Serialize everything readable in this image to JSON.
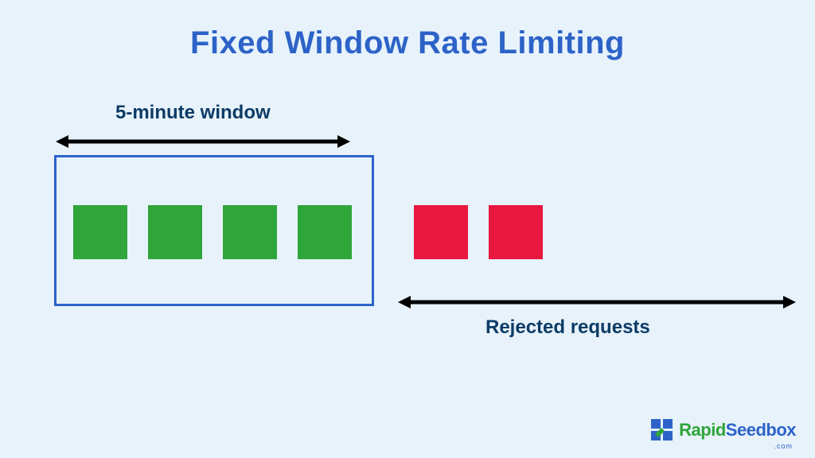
{
  "title": "Fixed Window Rate Limiting",
  "labels": {
    "window": "5-minute window",
    "rejected": "Rejected requests"
  },
  "requests": {
    "accepted_count": 4,
    "rejected_count": 2,
    "accepted_color": "#2fa53a",
    "rejected_color": "#e8173f"
  },
  "colors": {
    "background": "#e7f2fb",
    "title": "#2d63c8",
    "label": "#0d3b66",
    "window_border": "#2d63c8",
    "arrow": "#000000"
  },
  "brand": {
    "name_part1": "Rapid",
    "name_part2": "Seedbox",
    "subtext": ".com"
  }
}
